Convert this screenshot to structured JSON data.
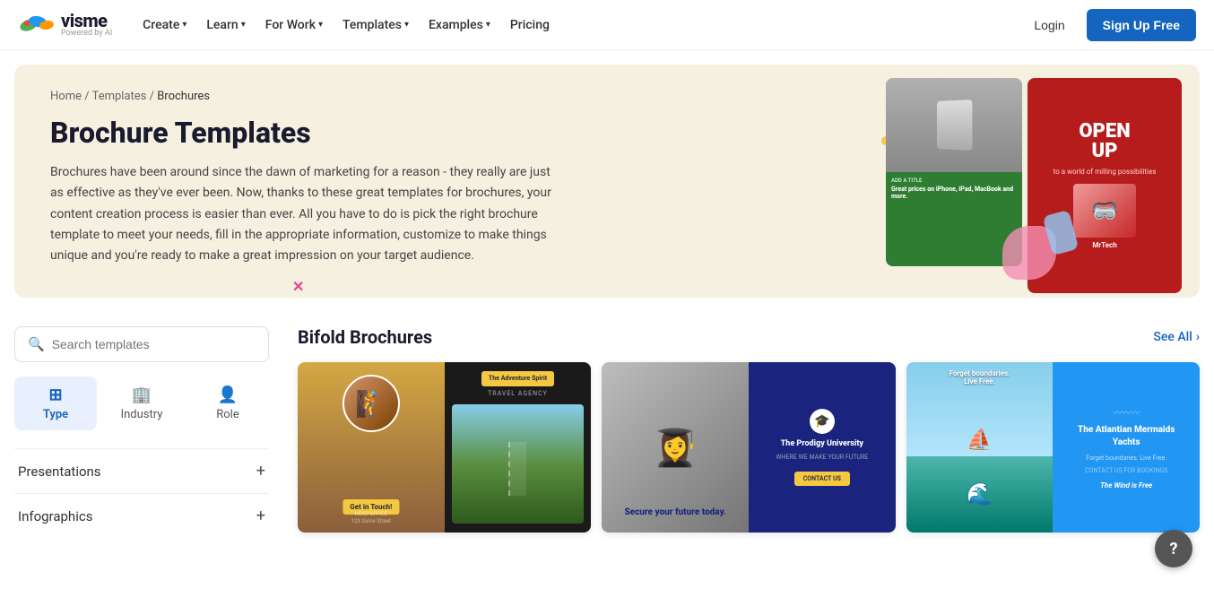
{
  "nav": {
    "logo_main": "visme",
    "logo_sub": "Powered by AI",
    "items": [
      {
        "label": "Create",
        "has_dropdown": true
      },
      {
        "label": "Learn",
        "has_dropdown": true
      },
      {
        "label": "For Work",
        "has_dropdown": true
      },
      {
        "label": "Templates",
        "has_dropdown": true
      },
      {
        "label": "Examples",
        "has_dropdown": true
      },
      {
        "label": "Pricing",
        "has_dropdown": false
      }
    ],
    "login_label": "Login",
    "signup_label": "Sign Up Free"
  },
  "breadcrumb": {
    "home": "Home",
    "templates": "Templates",
    "current": "Brochures"
  },
  "hero": {
    "title": "Brochure Templates",
    "description": "Brochures have been around since the dawn of marketing for a reason - they really are just as effective as they've ever been. Now, thanks to these great templates for brochures, your content creation process is easier than ever. All you have to do is pick the right brochure template to meet your needs, fill in the appropriate information, customize to make things unique and you're ready to make a great impression on your target audience."
  },
  "sidebar": {
    "search_placeholder": "Search templates",
    "filter_tabs": [
      {
        "label": "Type",
        "icon": "⊞",
        "active": true
      },
      {
        "label": "Industry",
        "icon": "🏢",
        "active": false
      },
      {
        "label": "Role",
        "icon": "👤",
        "active": false
      }
    ],
    "sections": [
      {
        "label": "Presentations"
      },
      {
        "label": "Infographics"
      }
    ]
  },
  "template_section": {
    "title": "Bifold Brochures",
    "see_all_label": "See All",
    "cards": [
      {
        "name": "Adventure Spirit",
        "badge": "The Adventure Spirit",
        "sub": "TRAVEL AGENCY",
        "cta": "Get in Touch!"
      },
      {
        "name": "Prodigy University",
        "title": "The Prodigy University",
        "tagline": "WHERE WE MAKE YOUR FUTURE",
        "cta": "CONTACT US",
        "sub_cta": "Secure your future today."
      },
      {
        "name": "Atlantian Mermaids Yachts",
        "title": "The Atlantian Mermaids Yachts",
        "tagline": "Forget boundaries. Live Free.",
        "cta": "CONTACT US FOR BOOKINGS",
        "sub": "The Wind is Free"
      }
    ]
  },
  "help": {
    "label": "?"
  }
}
